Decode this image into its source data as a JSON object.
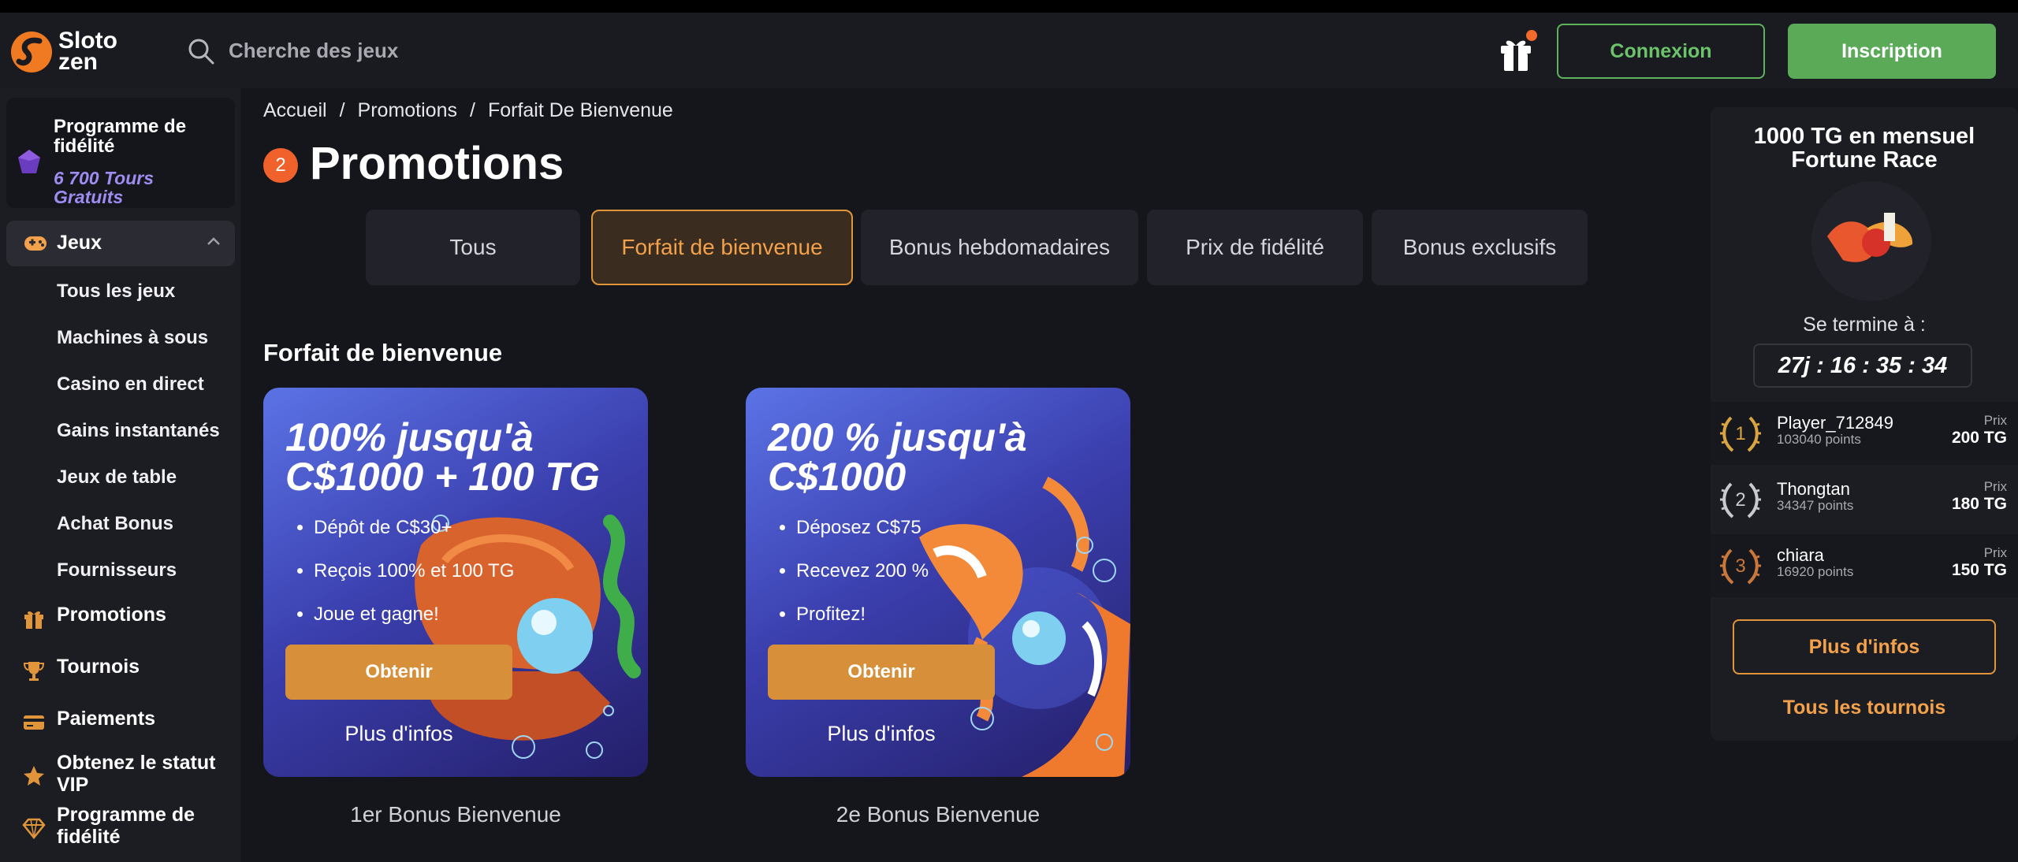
{
  "header": {
    "logo_line1": "Sloto",
    "logo_line2": "zen",
    "search_placeholder": "Cherche des jeux",
    "login_label": "Connexion",
    "signup_label": "Inscription"
  },
  "sidebar": {
    "loyalty_title": "Programme de fidélité",
    "loyalty_sub": "6 700 Tours Gratuits",
    "games_label": "Jeux",
    "games_items": [
      "Tous les jeux",
      "Machines à sous",
      "Casino en direct",
      "Gains instantanés",
      "Jeux de table",
      "Achat Bonus",
      "Fournisseurs"
    ],
    "nav": [
      {
        "label": "Promotions",
        "icon": "gift-icon"
      },
      {
        "label": "Tournois",
        "icon": "trophy-icon"
      },
      {
        "label": "Paiements",
        "icon": "card-icon"
      },
      {
        "label": "Obtenez le statut VIP",
        "icon": "star-icon"
      },
      {
        "label": "Programme de fidélité",
        "icon": "diamond-icon"
      }
    ]
  },
  "breadcrumb": [
    "Accueil",
    "/",
    "Promotions",
    "/",
    "Forfait De Bienvenue"
  ],
  "page": {
    "badge_count": "2",
    "title": "Promotions",
    "tabs": [
      "Tous",
      "Forfait de bienvenue",
      "Bonus hebdomadaires",
      "Prix de fidélité",
      "Bonus exclusifs"
    ],
    "active_tab": "Forfait de bienvenue",
    "section_title": "Forfait de bienvenue"
  },
  "offers": [
    {
      "headline": "100% jusqu'à C$1000 + 100 TG",
      "bullets": [
        "Dépôt de C$30+",
        "Reçois 100% et 100 TG",
        "Joue et gagne!"
      ],
      "button": "Obtenir",
      "more": "Plus d'infos",
      "caption": "1er Bonus Bienvenue"
    },
    {
      "headline": "200 % jusqu'à C$1000",
      "bullets": [
        "Déposez C$75",
        "Recevez 200 %",
        "Profitez!"
      ],
      "button": "Obtenir",
      "more": "Plus d'infos",
      "caption": "2e Bonus Bienvenue"
    }
  ],
  "tournament": {
    "title": "1000 TG en mensuel Fortune Race",
    "ends_label": "Se termine à :",
    "timer": "27j : 16 : 35 : 34",
    "leaderboard": [
      {
        "rank": "1",
        "name": "Player_712849",
        "points": "103040 points",
        "prize_label": "Prix",
        "prize": "200 TG",
        "color": "#d9a441"
      },
      {
        "rank": "2",
        "name": "Thongtan",
        "points": "34347 points",
        "prize_label": "Prix",
        "prize": "180 TG",
        "color": "#c9cad0"
      },
      {
        "rank": "3",
        "name": "chiara",
        "points": "16920 points",
        "prize_label": "Prix",
        "prize": "150 TG",
        "color": "#c9773a"
      }
    ],
    "more_label": "Plus d'infos",
    "all_label": "Tous les tournois"
  }
}
